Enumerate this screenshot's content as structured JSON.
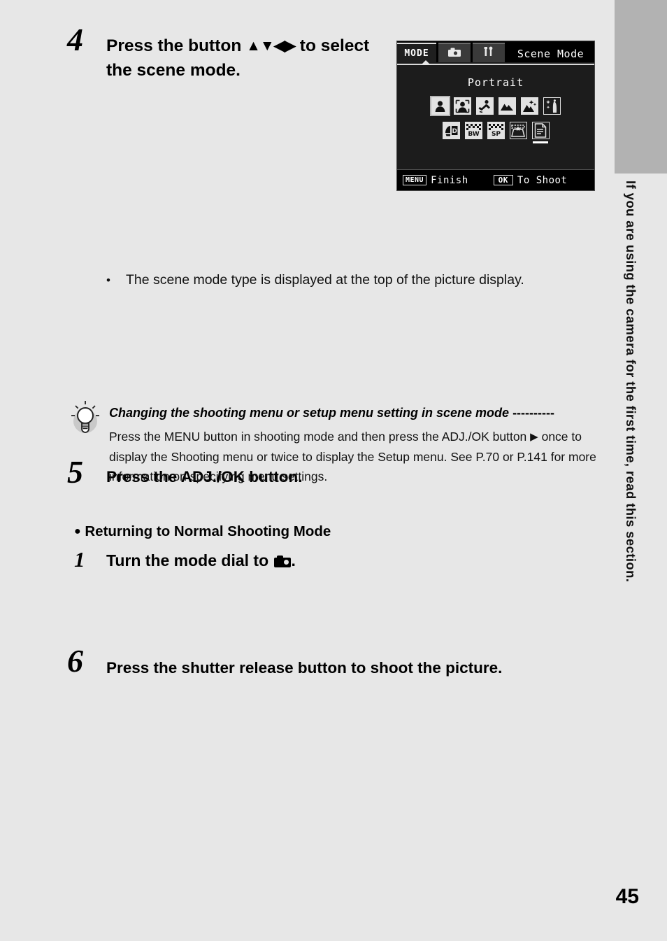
{
  "page": {
    "number": "45",
    "side_tab_text": "If you are using the camera for the first time, read this section.",
    "background_color": "#e7e7e7",
    "side_tab_color": "#b2b2b2"
  },
  "steps": [
    {
      "number": "4",
      "text_before": "Press the button",
      "arrows": "▲▼◀▶",
      "text_after": "to select the scene mode."
    },
    {
      "number": "5",
      "title": "Press the ADJ./OK button.",
      "bullet_dot": "•",
      "bullet_text": "The scene mode type is displayed at the top of the picture display."
    },
    {
      "number": "6",
      "title": "Press the shutter release button to shoot the picture."
    }
  ],
  "tip": {
    "icon": "lightbulb-icon",
    "title": "Changing the shooting menu or setup menu setting in scene mode",
    "title_dashes": "----------",
    "body_part1": "Press the MENU button in shooting mode and then press the ADJ./OK button",
    "body_arrow": "▶",
    "body_part2": "once to display the Shooting menu or twice to display the Setup menu. See P.70 or P.141 for more information on specifying menu settings."
  },
  "returning": {
    "bullet": "●",
    "heading": "Returning to Normal Shooting Mode",
    "step_number": "1",
    "step_text_before": "Turn the mode dial to",
    "step_icon": "camera-icon",
    "step_text_after": "."
  },
  "lcd": {
    "tabs": [
      {
        "label": "MODE",
        "name": "tab-mode",
        "active": true
      },
      {
        "label": "",
        "name": "tab-shooting",
        "icon": "camera-icon"
      },
      {
        "label": "",
        "name": "tab-setup",
        "icon": "wrench-icon"
      }
    ],
    "title": "Scene Mode",
    "selected_label": "Portrait",
    "scene_icons_row1": [
      {
        "name": "portrait-icon",
        "label": "Portrait",
        "selected": true
      },
      {
        "name": "face-icon",
        "label": "Face"
      },
      {
        "name": "sports-icon",
        "label": "Sports"
      },
      {
        "name": "landscape-icon",
        "label": "Landscape"
      },
      {
        "name": "nightscape-icon",
        "label": "Nightscape"
      },
      {
        "name": "night-portrait-icon",
        "label": "Night Portrait"
      }
    ],
    "scene_icons_row2": [
      {
        "name": "skew-correct-icon",
        "label": "Skew Correct Mode"
      },
      {
        "name": "black-white-icon",
        "label": "B&W"
      },
      {
        "name": "sepia-icon",
        "label": "Sepia"
      },
      {
        "name": "high-sens-icon",
        "label": "High Sens"
      },
      {
        "name": "text-mode-icon",
        "label": "Text Mode",
        "selected": true
      }
    ],
    "footer": {
      "menu_key": "MENU",
      "menu_action": "Finish",
      "ok_key": "OK",
      "ok_action": "To Shoot"
    }
  }
}
